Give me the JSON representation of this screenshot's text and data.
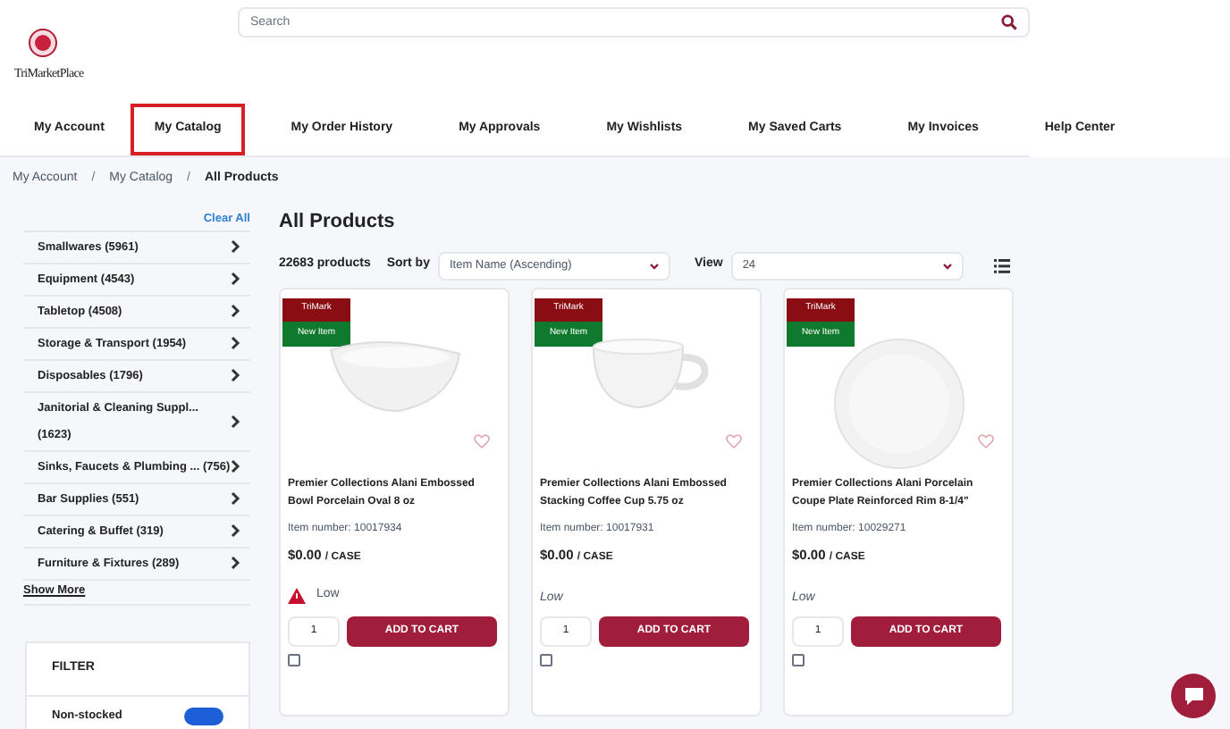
{
  "header": {
    "logo": {
      "text": "TriMarketPlace"
    },
    "search": {
      "placeholder": "Search"
    }
  },
  "nav": [
    {
      "label": "My Account",
      "selected": false
    },
    {
      "label": "My Catalog",
      "selected": true
    },
    {
      "label": "My Order History",
      "selected": false
    },
    {
      "label": "My Approvals",
      "selected": false
    },
    {
      "label": "My Wishlists",
      "selected": false
    },
    {
      "label": "My Saved Carts",
      "selected": false
    },
    {
      "label": "My Invoices",
      "selected": false
    },
    {
      "label": "Help Center",
      "selected": false
    }
  ],
  "breadcrumb": {
    "separator": "/",
    "items": [
      "My Account",
      "My Catalog",
      "All Products"
    ]
  },
  "sidebar": {
    "clear_all": "Clear All",
    "categories": [
      {
        "name": "Smallwares",
        "count": "(5961)"
      },
      {
        "name": "Equipment",
        "count": "(4543)"
      },
      {
        "name": "Tabletop",
        "count": "(4508)"
      },
      {
        "name": "Storage & Transport",
        "count": "(1954)"
      },
      {
        "name": "Disposables",
        "count": "(1796)"
      },
      {
        "name": "Janitorial & Cleaning Suppl...",
        "count": "(1623)"
      },
      {
        "name": "Sinks, Faucets & Plumbing ...",
        "count": "(756)"
      },
      {
        "name": "Bar Supplies",
        "count": "(551)"
      },
      {
        "name": "Catering & Buffet",
        "count": "(319)"
      },
      {
        "name": "Furniture & Fixtures",
        "count": "(289)"
      }
    ],
    "show_more": "Show More",
    "filter": {
      "title": "FILTER",
      "option": {
        "label": "Non-stocked",
        "on": true
      }
    }
  },
  "main": {
    "title": "All Products",
    "count": "22683 products",
    "sort": {
      "label": "Sort by",
      "value": "Item Name (Ascending)"
    },
    "view": {
      "label": "View",
      "value": "24"
    },
    "products": [
      {
        "brand": "TriMark",
        "badge": "New Item",
        "kind": "bowl",
        "name": "Premier Collections Alani Embossed Bowl Porcelain Oval 8 oz",
        "item_number": "Item number: 10017934",
        "price": "$0.00",
        "unit": "/ CASE",
        "stock": {
          "kind": "warning",
          "label": "Low"
        },
        "qty": "1",
        "button": "ADD TO CART",
        "compare": {
          "checked": false
        }
      },
      {
        "brand": "TriMark",
        "badge": "New Item",
        "kind": "cup",
        "name": "Premier Collections Alani Embossed Stacking Coffee Cup 5.75 oz",
        "item_number": "Item number: 10017931",
        "price": "$0.00",
        "unit": "/ CASE",
        "stock": {
          "kind": "plain",
          "label": "Low"
        },
        "qty": "1",
        "button": "ADD TO CART",
        "compare": {
          "checked": false
        }
      },
      {
        "brand": "TriMark",
        "badge": "New Item",
        "kind": "plate",
        "name": "Premier Collections Alani Porcelain Coupe Plate Reinforced Rim 8-1/4\"",
        "item_number": "Item number: 10029271",
        "price": "$0.00",
        "unit": "/ CASE",
        "stock": {
          "kind": "plain",
          "label": "Low"
        },
        "qty": "1",
        "button": "ADD TO CART",
        "compare": {
          "checked": false
        }
      }
    ]
  }
}
